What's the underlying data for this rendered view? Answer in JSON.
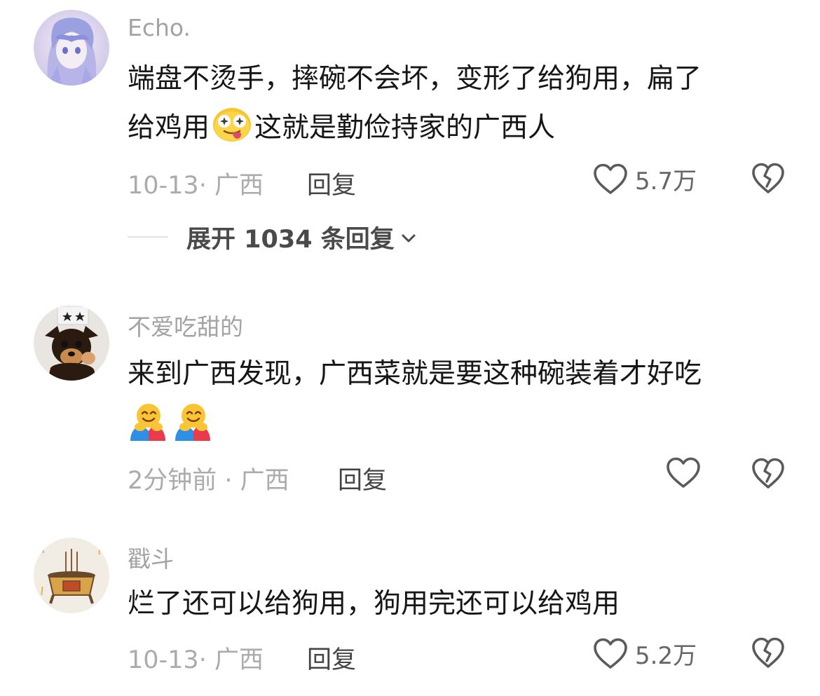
{
  "comments": [
    {
      "username": "Echo.",
      "text_line1": "端盘不烫手，摔碗不会坏，变形了给狗用，扁了",
      "text_line2a": "给鸡用",
      "text_line2b": "这就是勤俭持家的广西人",
      "emoji_icon": "drooling-face-icon",
      "meta": "10-13· 广西",
      "reply_label": "回复",
      "like_count": "5.7万",
      "expand_label": "展开 1034 条回复"
    },
    {
      "username": "不爱吃甜的",
      "text_line1": "来到广西发现，广西菜就是要这种碗装着才好吃",
      "emoji_icons": [
        "hugging-face-icon",
        "hugging-face-icon"
      ],
      "meta": "2分钟前 · 广西",
      "reply_label": "回复",
      "like_count": ""
    },
    {
      "username": "戳斗",
      "text_line1": "烂了还可以给狗用，狗用完还可以给鸡用",
      "meta": "10-13· 广西",
      "reply_label": "回复",
      "like_count": "5.2万"
    }
  ],
  "colors": {
    "username": "#a3a3a3",
    "body_text": "#161616",
    "meta": "#ababab",
    "icon_stroke": "#5a5a5a"
  }
}
